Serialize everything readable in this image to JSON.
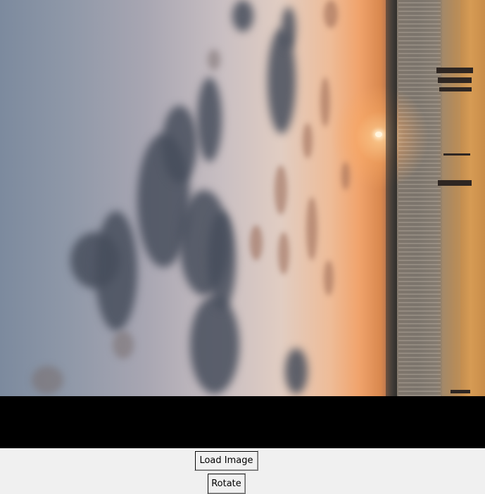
{
  "window": {
    "background": "#f0f0f0"
  },
  "canvas": {
    "background": "#000000",
    "image_description_icon": "sunset-beach-photo"
  },
  "controls": {
    "load_label": "Load Image",
    "rotate_label": "Rotate"
  }
}
